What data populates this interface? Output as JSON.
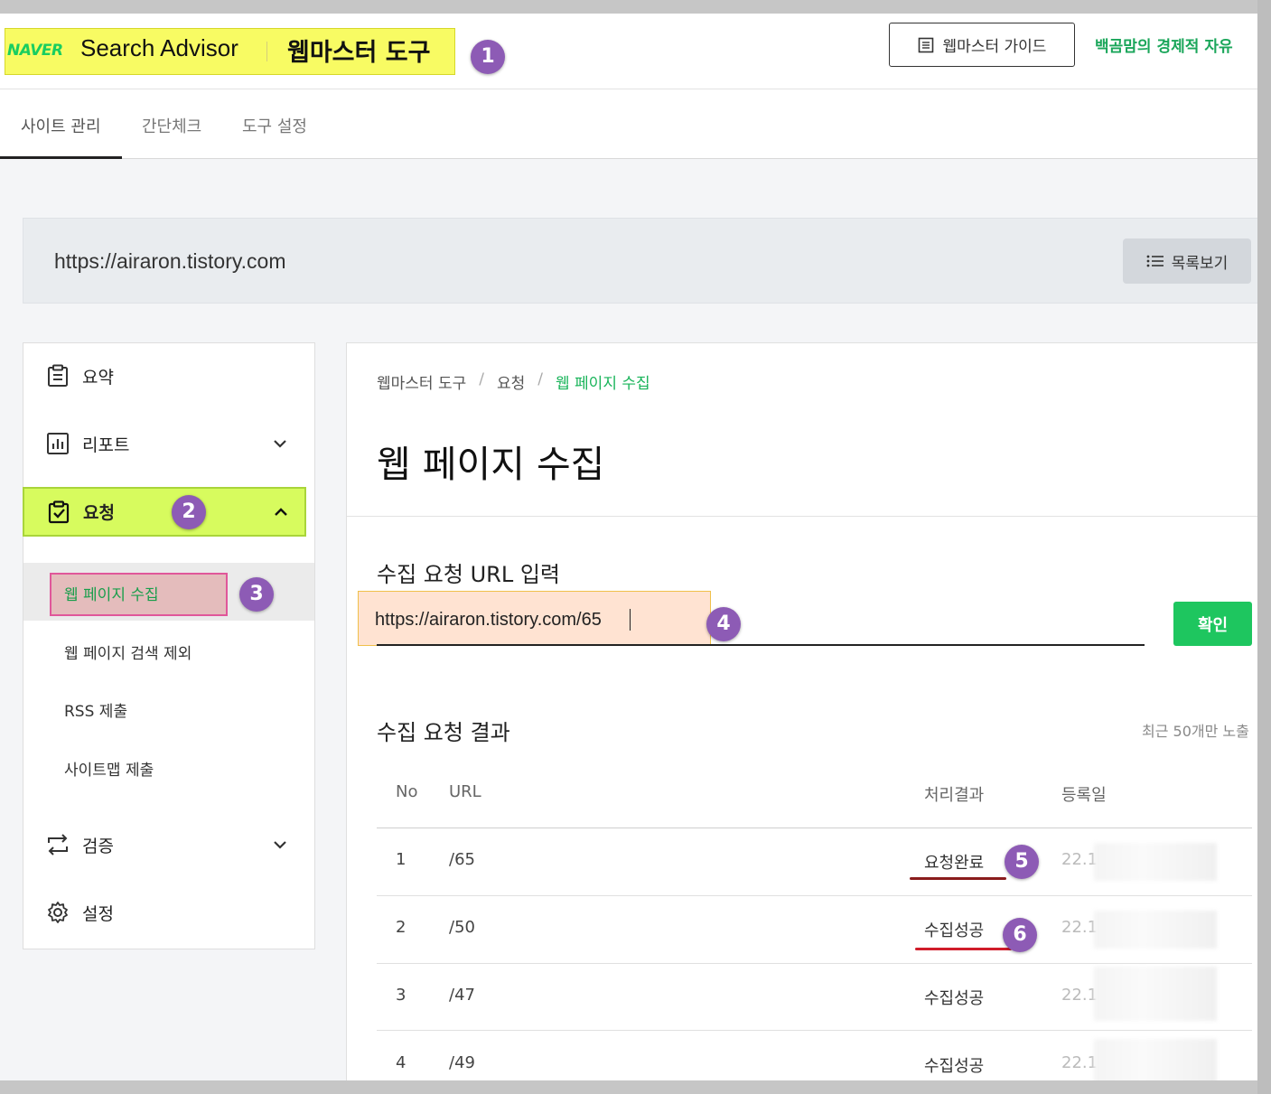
{
  "header": {
    "logo": "NAVER",
    "product": "Search Advisor",
    "tool": "웹마스터 도구",
    "guide_label": "웹마스터 가이드",
    "user_name": "백곰맘의 경제적 자유"
  },
  "tabs": [
    {
      "label": "사이트 관리",
      "active": true
    },
    {
      "label": "간단체크",
      "active": false
    },
    {
      "label": "도구 설정",
      "active": false
    }
  ],
  "site": {
    "url": "https://airaron.tistory.com",
    "list_button": "목록보기"
  },
  "sidebar": {
    "items": [
      {
        "label": "요약",
        "icon": "clipboard-icon"
      },
      {
        "label": "리포트",
        "icon": "chart-icon"
      },
      {
        "label": "요청",
        "icon": "clipboard-check-icon"
      },
      {
        "label": "검증",
        "icon": "swap-icon"
      },
      {
        "label": "설정",
        "icon": "gear-icon"
      }
    ],
    "sub_items": [
      {
        "label": "웹 페이지 수집",
        "active": true
      },
      {
        "label": "웹 페이지 검색 제외"
      },
      {
        "label": "RSS 제출"
      },
      {
        "label": "사이트맵 제출"
      }
    ]
  },
  "breadcrumb": [
    "웹마스터 도구",
    "요청",
    "웹 페이지 수집"
  ],
  "main": {
    "title": "웹 페이지 수집",
    "input_section": "수집 요청 URL 입력",
    "input_value": "https://airaron.tistory.com/65",
    "confirm_label": "확인",
    "result_section": "수집 요청 결과",
    "recent_note": "최근 50개만 노출",
    "columns": [
      "No",
      "URL",
      "처리결과",
      "등록일"
    ],
    "rows": [
      {
        "no": "1",
        "url": "/65",
        "result": "요청완료",
        "date": "22.1"
      },
      {
        "no": "2",
        "url": "/50",
        "result": "수집성공",
        "date": "22.1"
      },
      {
        "no": "3",
        "url": "/47",
        "result": "수집성공",
        "date": "22.1"
      },
      {
        "no": "4",
        "url": "/49",
        "result": "수집성공",
        "date": "22.1"
      }
    ]
  },
  "annotations": [
    "1",
    "2",
    "3",
    "4",
    "5",
    "6"
  ],
  "colors": {
    "accent_green": "#1ec65f",
    "highlight_yellow": "#f8fb63",
    "badge_purple": "#8d5bb5",
    "request_green": "#d7fb5e",
    "pink_highlight": "#e4bcbc",
    "peach_highlight": "#ffe3d2"
  }
}
